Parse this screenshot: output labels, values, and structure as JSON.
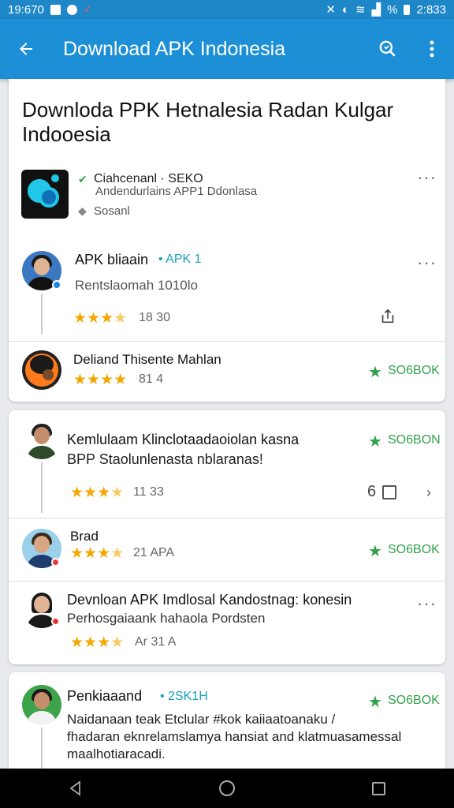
{
  "status_bar": {
    "time": "19:670",
    "battery": "2:833",
    "signal_text": "%"
  },
  "app_bar": {
    "title": "Download APK Indonesia"
  },
  "page": {
    "heading": "Downloda PPK Hetnalesia Radan Kulgar Indooesia"
  },
  "app_info": {
    "name": "Ciahcenanl · SEKO",
    "subtitle": "Andendurlains APP1 Ddonlasa",
    "meta": "Sosanl"
  },
  "reviews": [
    {
      "author": "APK bliaain",
      "tag": "• APK 1",
      "text": "Rentslaomah  1010lo",
      "rating": 3.5,
      "count": "18 30"
    },
    {
      "author": "Deliand Thisente Mahlan",
      "rating": 4,
      "count": "81 4",
      "badge": "SO6BOK"
    },
    {
      "author": "Kemlulaam Klinclotaadaoiolan kasna",
      "text": "BPP Staolunlenasta nblaranas!",
      "rating": 3.5,
      "count": "11 33",
      "badge": "SO6BON",
      "reply_count": "6"
    },
    {
      "author": "Brad",
      "rating": 3.5,
      "count": "21 APA",
      "badge": "SO6BOK"
    },
    {
      "author": "Devnloan APK Imdlosal Kandostnag: konesin",
      "text": "Perhosgaiaank hahaola Pordsten",
      "rating": 3.5,
      "count": "Ar 31 A"
    },
    {
      "author": "Penkiaaand",
      "tag": "• 2SK1H",
      "text_line1": "Naidanaan teak Etclular #kok kaiiaatoanaku /",
      "text_line2": "fhadaran eknrelamslamya hansiat and klatmuasamessal",
      "text_line3": "maalhotiaracadi.",
      "badge": "SO6BOK"
    }
  ],
  "icons": {
    "back": "arrow-left-icon",
    "search": "search-icon",
    "menu": "more-vert-icon",
    "share": "share-icon"
  },
  "colors": {
    "app_bar": "#1d8fd6",
    "status_bar": "#1d87c8",
    "star": "#f4a700",
    "green_badge": "#31a24c"
  }
}
